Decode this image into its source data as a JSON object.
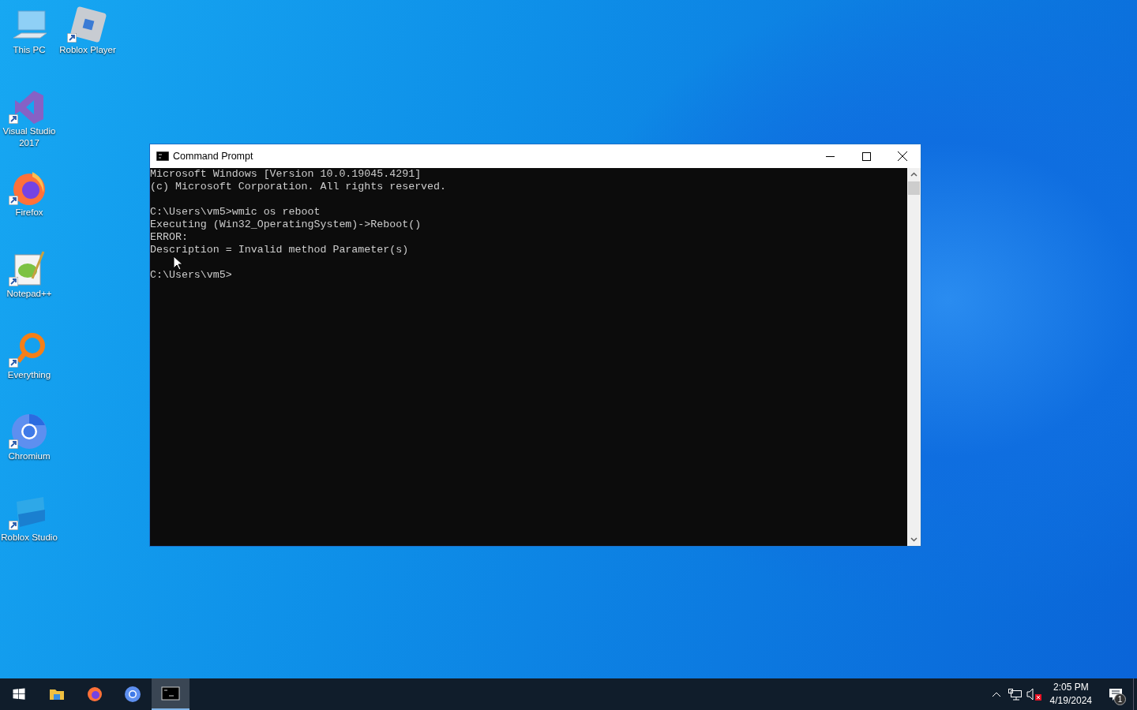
{
  "desktop_icons": [
    {
      "label": "This PC"
    },
    {
      "label": "Roblox Player",
      "shortcut": true
    },
    {
      "label": "Visual Studio 2017",
      "shortcut": true
    },
    {
      "label": "Firefox",
      "shortcut": true
    },
    {
      "label": "Notepad++",
      "shortcut": true
    },
    {
      "label": "Everything",
      "shortcut": true
    },
    {
      "label": "Chromium",
      "shortcut": true
    },
    {
      "label": "Roblox Studio",
      "shortcut": true
    }
  ],
  "window": {
    "title": "Command Prompt",
    "console_blocks": [
      [
        "Microsoft Windows [Version 10.0.19045.4291]",
        "(c) Microsoft Corporation. All rights reserved."
      ],
      [
        "C:\\Users\\vm5>wmic os reboot",
        "Executing (Win32_OperatingSystem)->Reboot()",
        "ERROR:",
        "Description = Invalid method Parameter(s)"
      ],
      [
        "C:\\Users\\vm5>"
      ]
    ]
  },
  "taskbar": {
    "apps": [
      {
        "selected": false
      },
      {
        "selected": false
      },
      {
        "selected": false
      },
      {
        "selected": true
      }
    ],
    "tray": {
      "volume_muted": true,
      "time": "2:05 PM",
      "date": "4/19/2024",
      "notification_count": "1"
    }
  }
}
